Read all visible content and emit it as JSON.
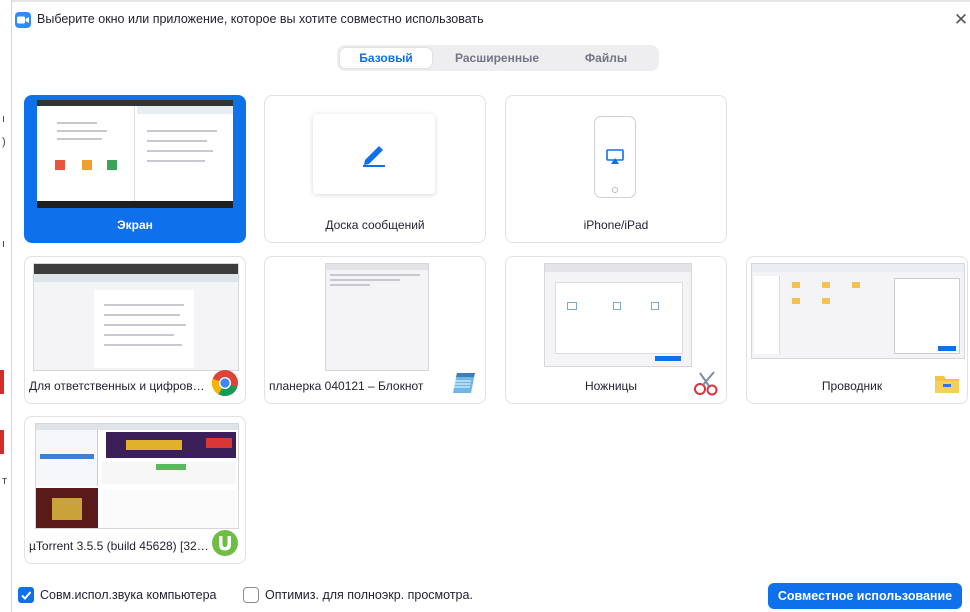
{
  "window": {
    "title": "Выберите окно или приложение, которое вы хотите совместно использовать"
  },
  "tabs": [
    {
      "label": "Базовый",
      "active": true
    },
    {
      "label": "Расширенные",
      "active": false
    },
    {
      "label": "Файлы",
      "active": false
    }
  ],
  "tiles": {
    "screen": {
      "label": "Экран",
      "selected": true,
      "icon": "screen-thumbnail"
    },
    "whiteboard": {
      "label": "Доска сообщений",
      "icon": "pen-icon"
    },
    "iphone": {
      "label": "iPhone/iPad",
      "icon": "airplay-icon"
    },
    "chrome": {
      "label": "Для ответственных и цифровых...",
      "icon": "chrome-icon"
    },
    "notepad": {
      "label": "планерка 040121 – Блокнот",
      "icon": "notepad-icon"
    },
    "snipping": {
      "label": "Ножницы",
      "icon": "scissors-icon"
    },
    "explorer": {
      "label": "Проводник",
      "icon": "folder-icon"
    },
    "utorrent": {
      "label": "µTorrent 3.5.5  (build 45628) [32-b...",
      "icon": "utorrent-icon"
    }
  },
  "footer": {
    "share_audio_label": "Совм.испол.звука компьютера",
    "share_audio_checked": true,
    "optimize_label": "Оптимиз. для полноэкр. просмотра.",
    "optimize_checked": false,
    "share_button_label": "Совместное использование"
  },
  "colors": {
    "accent": "#0e71eb",
    "tab_bg": "#eeeef1",
    "text": "#232333"
  }
}
